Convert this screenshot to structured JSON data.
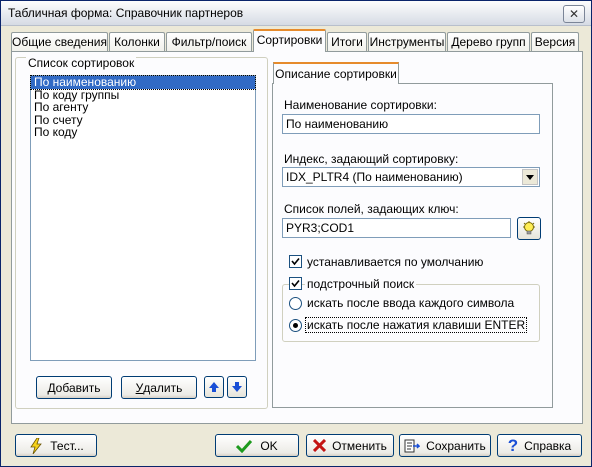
{
  "window": {
    "title": "Табличная форма:  Справочник партнеров",
    "close_glyph": "✕"
  },
  "tabs": [
    {
      "label": "Общие сведения"
    },
    {
      "label": "Колонки"
    },
    {
      "label": "Фильтр/поиск"
    },
    {
      "label": "Сортировки"
    },
    {
      "label": "Итоги"
    },
    {
      "label": "Инструменты"
    },
    {
      "label": "Дерево групп"
    },
    {
      "label": "Версия"
    }
  ],
  "active_tab": "Сортировки",
  "sort_list": {
    "legend": "Список сортировок",
    "items": [
      "По наименованию",
      "По коду группы",
      "По агенту",
      "По счету",
      "По коду"
    ],
    "selected_index": 0,
    "add_label": "Добавить",
    "add_underline": "Д",
    "add_rest": "обавить",
    "delete_label": "Удалить",
    "delete_underline": "У",
    "delete_rest": "далить",
    "up_icon": "arrow-up",
    "down_icon": "arrow-down"
  },
  "description": {
    "tab_label": "Описание сортировки",
    "name_label": "Наименование сортировки:",
    "name_value": "По наименованию",
    "index_label": "Индекс, задающий сортировку:",
    "index_value": "IDX_PLTR4 (По наименованию)",
    "fields_label": "Список полей, задающих ключ:",
    "fields_value": "PYR3;COD1",
    "default_label": "устанавливается по умолчанию",
    "default_checked": true,
    "substring_label": "подстрочный поиск",
    "substring_checked": true,
    "radio_each_char": "искать после ввода каждого символа",
    "radio_enter": "искать после нажатия клавиши ENTER",
    "radio_selected": "enter"
  },
  "footer": {
    "test_label": "Тест...",
    "ok_label": "OK",
    "cancel_label": "Отменить",
    "save_label": "Сохранить",
    "help_label": "Справка"
  },
  "colors": {
    "selection": "#316ac5",
    "tab_accent": "#e68b2c",
    "arrow_blue": "#1a4fd6"
  }
}
